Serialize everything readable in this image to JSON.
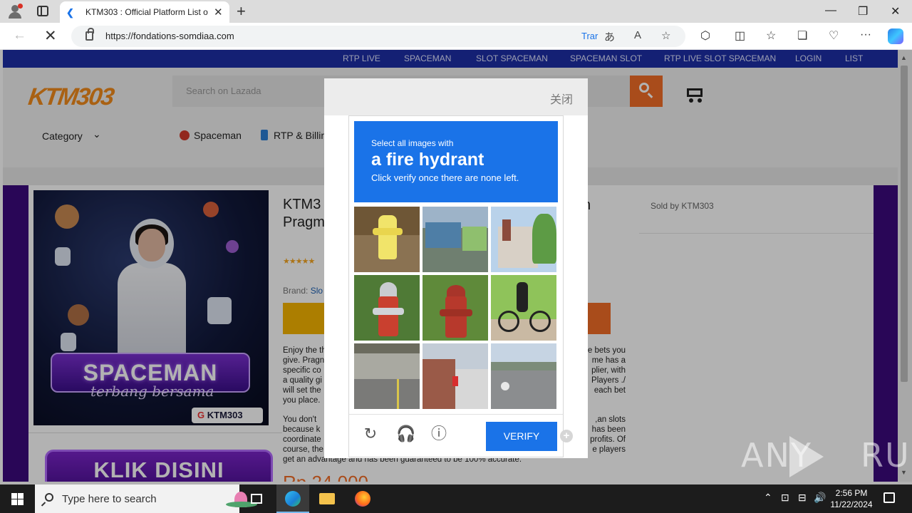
{
  "browser": {
    "tab_title": "KTM303 : Official Platform List of",
    "url": "https://fondations-somdiaa.com",
    "translate_label": "Trar",
    "back_icon": "arrow-left-icon",
    "stop_icon": "close-icon"
  },
  "site": {
    "topnav": [
      "RTP LIVE",
      "SPACEMAN",
      "SLOT SPACEMAN",
      "SPACEMAN SLOT",
      "RTP LIVE SLOT SPACEMAN",
      "LOGIN",
      "LIST"
    ],
    "logo": "KTM303",
    "search_placeholder": "Search on Lazada",
    "category_label": "Category",
    "header_links": [
      "Spaceman",
      "RTP & Billin"
    ],
    "accent_color": "#f36e28",
    "nav_color": "#1e2ea6",
    "side_color": "#3b0a7d"
  },
  "product": {
    "title_line1": "KTM3",
    "title_line2": "Pragm",
    "title_right": "n",
    "sold_by": "Sold by KTM303",
    "stars": "★★★★★",
    "brand_label": "Brand:",
    "brand_value": "Slo",
    "image_banner": "SPACEMAN",
    "image_subtitle": "terbang bersama",
    "image_tag": "KTM303",
    "cta_banner": "KLIK DISINI",
    "price": "Rp 24.000",
    "desc_left": [
      "Enjoy the th",
      "give. Pragn",
      "specific co",
      "a quality gi",
      "will set the",
      "you place.",
      "",
      "You don't",
      "because k",
      "coordinate",
      "course, the",
      "get an advantage and has been guaranteed to be 100% accurate."
    ],
    "desc_right": [
      "e bets you",
      "me has a",
      "plier, with",
      "/. Players",
      "each bet",
      "",
      "",
      "an slots,",
      "has been",
      "profits. Of",
      "e players"
    ]
  },
  "captcha": {
    "close_label": "关闭",
    "prompt_small": "Select all images with",
    "prompt_big": "a fire hydrant",
    "prompt_hint": "Click verify once there are none left.",
    "verify_label": "VERIFY",
    "icons": [
      "refresh-icon",
      "headphones-icon",
      "info-icon"
    ],
    "tiles": [
      "yellow hydrant",
      "houses street",
      "house with tree",
      "grey-red hydrant",
      "red hydrant",
      "cyclist",
      "road bridge",
      "street building",
      "road scooter"
    ],
    "brand_color": "#1a73e8"
  },
  "watermark": "ANY RUN",
  "taskbar": {
    "search_placeholder": "Type here to search",
    "time": "2:56 PM",
    "date": "11/22/2024"
  }
}
